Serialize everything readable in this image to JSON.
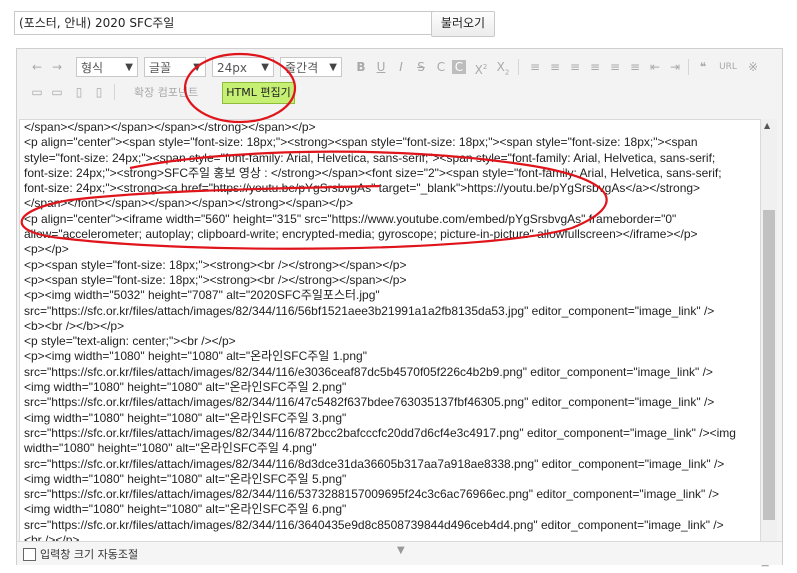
{
  "title_value": "(포스터, 안내) 2020 SFC주일",
  "load_button": "불러오기",
  "toolbar": {
    "row1": {
      "undo_icon": "←",
      "redo_icon": "→",
      "format_select": "형식",
      "font_select": "글꼴",
      "size_select": "24px",
      "spacing_select": "줄간격",
      "bold": "B",
      "underline": "U",
      "italic": "I",
      "strike": "S",
      "color": "C",
      "bgcolor": "C",
      "superscript": "X",
      "subscript": "X",
      "align_left": "≡",
      "align_center": "≡",
      "align_right": "≡",
      "align_justify": "≡",
      "ordered_list": "≡",
      "unordered_list": "≡",
      "outdent": "⇤",
      "indent": "⇥",
      "quote": "❝",
      "url": "URL",
      "special_char": "※"
    },
    "row2": {
      "table_icon": "▭",
      "table2_icon": "▭",
      "cell_icon": "▯",
      "cell2_icon": "▯",
      "extension_label": "확장 컴포넌트",
      "html_button": "HTML 편집기"
    }
  },
  "code_lines": [
    "</span></span></span></span></strong></span></p>",
    "<p align=\"center\"><span style=\"font-size: 18px;\"><strong><span style=\"font-size: 18px;\"><span style=\"font-size: 18px;\"><span",
    "style=\"font-size: 24px;\"><span style=\"font-family: Arial, Helvetica, sans-serif;\"><span style=\"font-family: Arial, Helvetica, sans-serif;",
    "font-size: 24px;\"><strong>SFC주일 홍보 영상 : </strong></span><font size=\"2\"><span style=\"font-family: Arial, Helvetica, sans-serif;",
    "font-size: 24px;\"><strong><a href=\"https://youtu.be/pYgSrsbvgAs\" target=\"_blank\">https://youtu.be/pYgSrsbvgAs</a></strong>",
    "</span></font></span></span></span></strong></span></p>",
    "<p align=\"center\"><iframe width=\"560\" height=\"315\" src=\"https://www.youtube.com/embed/pYgSrsbvgAs\" frameborder=\"0\"",
    "allow=\"accelerometer; autoplay; clipboard-write; encrypted-media; gyroscope; picture-in-picture\" allowfullscreen></iframe></p>",
    "<p></p>",
    "<p><span style=\"font-size: 18px;\"><strong><br /></strong></span></p>",
    "<p><span style=\"font-size: 18px;\"><strong><br /></strong></span></p>",
    "<p><img width=\"5032\" height=\"7087\" alt=\"2020SFC주일포스터.jpg\"",
    "src=\"https://sfc.or.kr/files/attach/images/82/344/116/56bf1521aee3b21991a1a2fb8135da53.jpg\" editor_component=\"image_link\" />",
    "<b><br /></b></p>",
    "<p style=\"text-align: center;\"><br /></p>",
    "<p><img width=\"1080\" height=\"1080\" alt=\"온라인SFC주일 1.png\"",
    "src=\"https://sfc.or.kr/files/attach/images/82/344/116/e3036ceaf87dc5b4570f05f226c4b2b9.png\" editor_component=\"image_link\" />",
    "<img width=\"1080\" height=\"1080\" alt=\"온라인SFC주일 2.png\"",
    "src=\"https://sfc.or.kr/files/attach/images/82/344/116/47c5482f637bdee763035137fbf46305.png\" editor_component=\"image_link\" />",
    "<img width=\"1080\" height=\"1080\" alt=\"온라인SFC주일 3.png\"",
    "src=\"https://sfc.or.kr/files/attach/images/82/344/116/872bcc2bafcccfc20dd7d6cf4e3c4917.png\" editor_component=\"image_link\" /><img",
    "width=\"1080\" height=\"1080\" alt=\"온라인SFC주일 4.png\"",
    "src=\"https://sfc.or.kr/files/attach/images/82/344/116/8d3dce31da36605b317aa7a918ae8338.png\" editor_component=\"image_link\" />",
    "<img width=\"1080\" height=\"1080\" alt=\"온라인SFC주일 5.png\"",
    "src=\"https://sfc.or.kr/files/attach/images/82/344/116/5373288157009695f24c3c6ac76966ec.png\" editor_component=\"image_link\" />",
    "<img width=\"1080\" height=\"1080\" alt=\"온라인SFC주일 6.png\"",
    "src=\"https://sfc.or.kr/files/attach/images/82/344/116/3640435e9d8c8508739844d496ceb4d4.png\" editor_component=\"image_link\" />",
    "<br /></p>"
  ],
  "footer": {
    "autosize_label": "입력창 크기 자동조절",
    "grip_icon": "▼",
    "resize_icon": "◢"
  },
  "scrollbar": {
    "up_icon": "▲",
    "down_icon": "▼"
  },
  "annotation_color": "#e0141b"
}
